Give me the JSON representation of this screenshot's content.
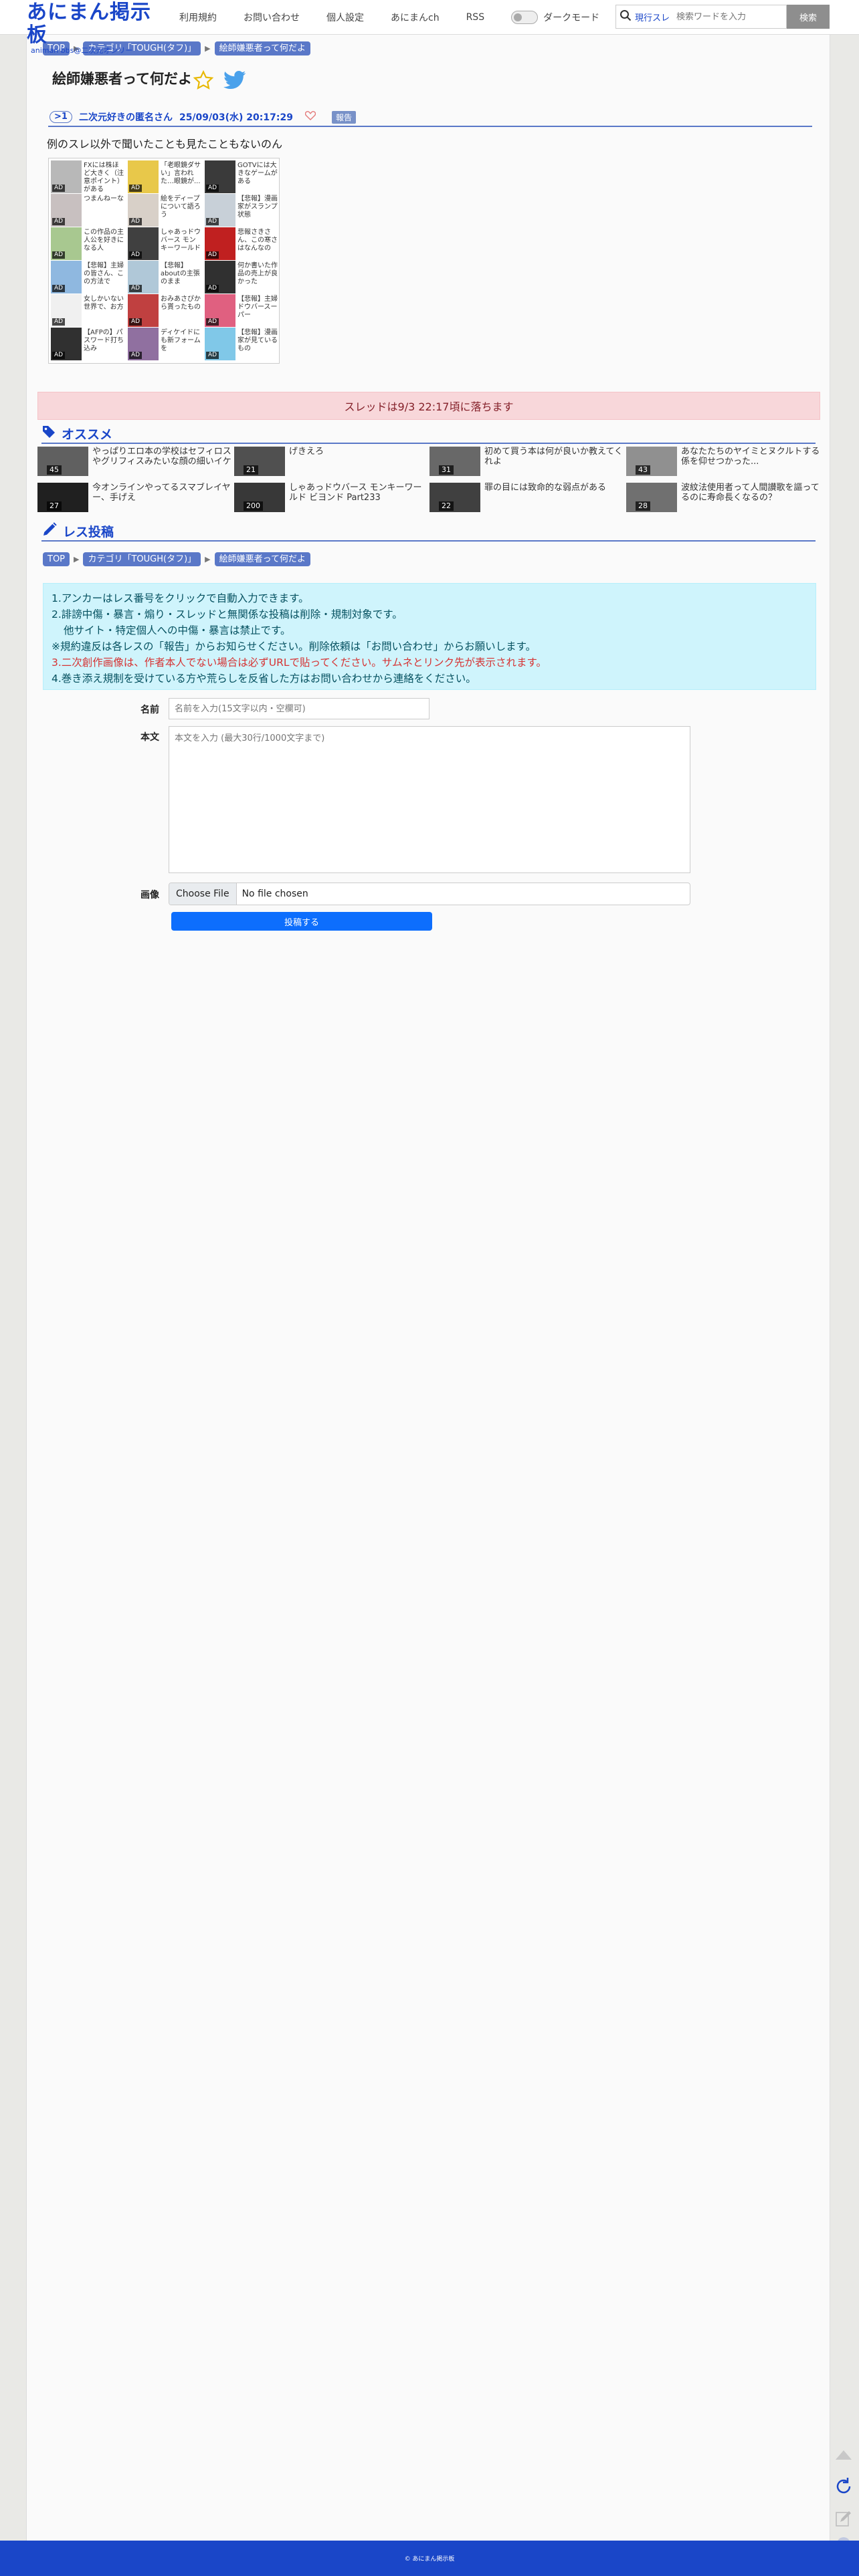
{
  "header": {
    "logo_main": "あにまん掲示板",
    "logo_sub": "animan bbs@二次元オンリー",
    "nav": [
      "利用規約",
      "お問い合わせ",
      "個人設定",
      "あにまんch",
      "RSS"
    ],
    "dark_mode_label": "ダークモード",
    "search_mode": "現行スレ",
    "search_placeholder": "検索ワードを入力",
    "search_button": "検索"
  },
  "breadcrumb": {
    "top": "TOP",
    "category": "カテゴリ「TOUGH(タフ)」",
    "current": "絵師嫌悪者って何だよ"
  },
  "thread": {
    "title": "絵師嫌悪者って何だよ",
    "post": {
      "number": ">1",
      "author": "二次元好きの匿名さん",
      "date": "25/09/03(水) 20:17:29",
      "report_label": "報告",
      "body": "例のスレ以外で聞いたことも見たこともないのん"
    }
  },
  "ad_grid": [
    {
      "text": "FXには株ほど大きく（注意ポイント）がある",
      "count": "AD",
      "color": "#b8b8b8"
    },
    {
      "text": "「老眼鏡ダサい」言われた…眼鏡が...",
      "count": "AD",
      "color": "#e8c84a"
    },
    {
      "text": "GOTVには大きなゲームがある",
      "count": "AD",
      "color": "#3a3a3a"
    },
    {
      "text": "つまんねーな",
      "count": "AD",
      "color": "#c8c0c0"
    },
    {
      "text": "絵をディープについて語ろう",
      "count": "AD",
      "color": "#d8d0c8"
    },
    {
      "text": "【悲報】漫画家がスランプ状態",
      "count": "AD",
      "color": "#c8d0d8"
    },
    {
      "text": "この作品の主人公を好きになる人",
      "count": "AD",
      "color": "#a8c890"
    },
    {
      "text": "しゃあっドウバース モンキーワールド",
      "count": "AD",
      "color": "#404040"
    },
    {
      "text": "悲報さきさん、この寒さはなんなの",
      "count": "AD",
      "color": "#c02020"
    },
    {
      "text": "【悲報】主婦の皆さん、この方法で",
      "count": "AD",
      "color": "#8fb8e0"
    },
    {
      "text": "【悲報】aboutの主張のまま",
      "count": "AD",
      "color": "#b0c8d8"
    },
    {
      "text": "何か書いた作品の売上が良かった",
      "count": "AD",
      "color": "#303030"
    },
    {
      "text": "女しかいない世界で、お方",
      "count": "AD",
      "color": "#f0f0f0"
    },
    {
      "text": "おみあさぴから貰ったもの",
      "count": "AD",
      "color": "#c04040"
    },
    {
      "text": "【悲報】主婦 ドウバースーパー",
      "count": "AD",
      "color": "#e06080"
    },
    {
      "text": "【AFPの】パスワード打ち込み",
      "count": "AD",
      "color": "#303030"
    },
    {
      "text": "ディケイドにも新フォームを",
      "count": "AD",
      "color": "#9070a0"
    },
    {
      "text": "【悲報】漫画家が見ているもの",
      "count": "AD",
      "color": "#80c8e8"
    }
  ],
  "fall_notice": "スレッドは9/3 22:17頃に落ちます",
  "recommend": {
    "title": "オススメ",
    "items": [
      {
        "text": "やっぱりエロ本の学校はセフィロスやグリフィスみたいな顔の細いイケメンがいいよねババ",
        "count": "45",
        "color": "#606060"
      },
      {
        "text": "げきえろ",
        "count": "21",
        "color": "#505050"
      },
      {
        "text": "初めて買う本は何が良いか教えてくれよ",
        "count": "31",
        "color": "#686868"
      },
      {
        "text": "あなたたちのヤイミとヌクルトする係を仰せつかった...",
        "count": "43",
        "color": "#909090"
      },
      {
        "text": "今オンラインやってるスマブレイヤー、手げえ",
        "count": "27",
        "color": "#202020"
      },
      {
        "text": "しゃあっドウバース モンキーワールド ビヨンド Part233",
        "count": "200",
        "color": "#383838"
      },
      {
        "text": "罪の目には致命的な弱点がある",
        "count": "22",
        "color": "#404040"
      },
      {
        "text": "波紋法使用者って人間讃歌を謳ってるのに寿命長くなるの？",
        "count": "28",
        "color": "#707070"
      }
    ]
  },
  "post_form": {
    "title": "レス投稿",
    "rules": [
      "1.アンカーはレス番号をクリックで自動入力できます。",
      "2.誹謗中傷・暴言・煽り・スレッドと無関係な投稿は削除・規制対象です。",
      "他サイト・特定個人への中傷・暴言は禁止です。",
      "※規約違反は各レスの「報告」からお知らせください。削除依頼は「お問い合わせ」からお願いします。",
      "3.二次創作画像は、作者本人でない場合は必ずURLで貼ってください。サムネとリンク先が表示されます。",
      "4.巻き添え規制を受けている方や荒らしを反省した方はお問い合わせから連絡をください。"
    ],
    "name_label": "名前",
    "name_placeholder": "名前を入力(15文字以内・空欄可)",
    "body_label": "本文",
    "body_placeholder": "本文を入力 (最大30行/1000文字まで)",
    "image_label": "画像",
    "file_button": "Choose File",
    "file_status": "No file chosen",
    "submit_label": "投稿する"
  },
  "footer": "© あにまん掲示板",
  "colors": {
    "brand": "#1a46c8",
    "crumb": "#5a78c8",
    "notice_bg": "#f8d7da",
    "rules_bg": "#cff4fc",
    "submit": "#0d6efd"
  }
}
